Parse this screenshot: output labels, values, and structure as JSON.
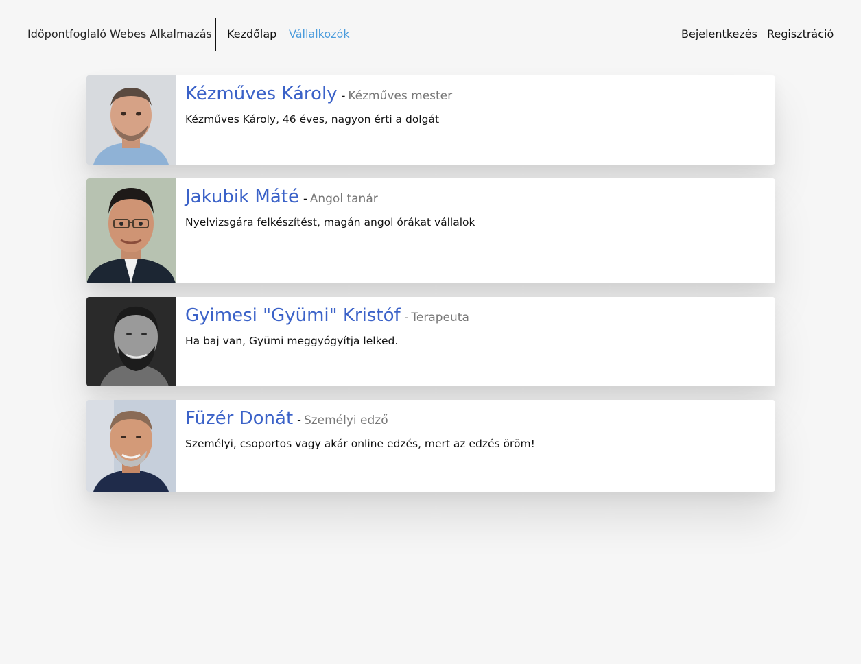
{
  "header": {
    "brand": "Időpontfoglaló Webes Alkalmazás",
    "nav": {
      "home": "Kezdőlap",
      "providers": "Vállalkozók"
    },
    "auth": {
      "login": "Bejelentkezés",
      "register": "Regisztráció"
    }
  },
  "providers": [
    {
      "name": "Kézműves Károly",
      "separator": "-",
      "role": "Kézműves mester",
      "description": "Kézműves Károly, 46 éves, nagyon érti a dolgát"
    },
    {
      "name": "Jakubik Máté",
      "separator": "-",
      "role": "Angol tanár",
      "description": "Nyelvizsgára felkészítést, magán angol órákat vállalok"
    },
    {
      "name": "Gyimesi \"Gyümi\" Kristóf",
      "separator": "-",
      "role": "Terapeuta",
      "description": "Ha baj van, Gyümi meggyógyítja lelked."
    },
    {
      "name": "Füzér Donát",
      "separator": "-",
      "role": "Személyi edző",
      "description": "Személyi, csoportos vagy akár online edzés, mert az edzés öröm!"
    }
  ],
  "colors": {
    "background": "#f6f6f6",
    "name": "#3b62c8",
    "active_nav": "#4a9bdc",
    "role": "#777777"
  }
}
